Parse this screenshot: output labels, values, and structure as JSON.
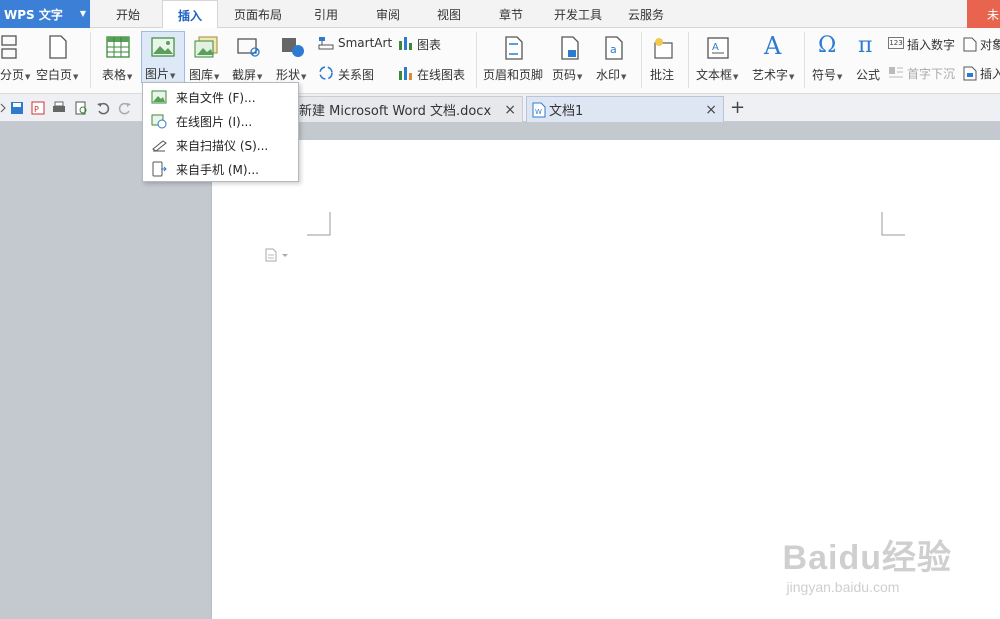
{
  "app": {
    "title": "WPS 文字"
  },
  "menu_tabs": [
    {
      "label": "开始"
    },
    {
      "label": "插入"
    },
    {
      "label": "页面布局"
    },
    {
      "label": "引用"
    },
    {
      "label": "审阅"
    },
    {
      "label": "视图"
    },
    {
      "label": "章节"
    },
    {
      "label": "开发工具"
    },
    {
      "label": "云服务"
    }
  ],
  "menu_right": {
    "label": "未"
  },
  "ribbon": {
    "page_break": "分页",
    "blank_page": "空白页",
    "table": "表格",
    "picture": "图片",
    "gallery": "图库",
    "screenshot": "截屏",
    "shapes": "形状",
    "smartart": "SmartArt",
    "chart": "图表",
    "relation_chart": "关系图",
    "online_chart": "在线图表",
    "header_footer": "页眉和页脚",
    "page_number": "页码",
    "watermark": "水印",
    "comment": "批注",
    "text_box": "文本框",
    "word_art": "艺术字",
    "symbol": "符号",
    "formula": "公式",
    "insert_number": "插入数字",
    "drop_cap": "首字下沉",
    "object": "对象",
    "insert_more": "插入"
  },
  "doc_tabs": [
    {
      "label": "新建 Microsoft Word 文档.docx"
    },
    {
      "label": "文档1"
    }
  ],
  "picture_menu": [
    {
      "label": "来自文件 (F)..."
    },
    {
      "label": "在线图片 (I)..."
    },
    {
      "label": "来自扫描仪 (S)..."
    },
    {
      "label": "来自手机 (M)..."
    }
  ],
  "watermark_text": {
    "brand": "Baidu经验",
    "url": "jingyan.baidu.com"
  },
  "colors": {
    "accent": "#3b7fd6",
    "active_tab_text": "#1b62c0",
    "unreg": "#e8644f"
  }
}
